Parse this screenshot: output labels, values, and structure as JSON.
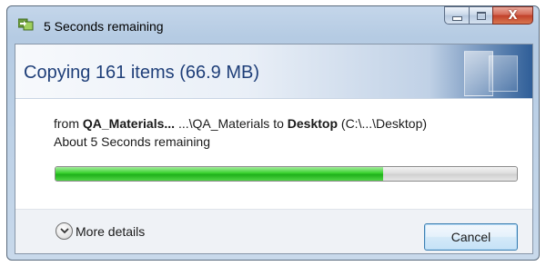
{
  "window": {
    "title": "5 Seconds remaining",
    "title_icon": "copy-progress-icon"
  },
  "caption_buttons": {
    "minimize_icon": "minimize-icon",
    "maximize_icon": "maximize-icon",
    "close_glyph": "X"
  },
  "header": {
    "title": "Copying 161 items (66.9 MB)"
  },
  "transfer": {
    "from_word": "from",
    "source_name": "QA_Materials...",
    "source_path": "...\\QA_Materials",
    "to_word": "to",
    "destination_name": "Desktop",
    "destination_path": "(C:\\...\\Desktop)",
    "remaining_text": "About 5 Seconds remaining"
  },
  "progress": {
    "fraction": 0.71,
    "color": "#22b61d"
  },
  "footer": {
    "more_details_label": "More details",
    "more_details_icon": "chevron-down-icon",
    "cancel_label": "Cancel"
  },
  "colors": {
    "header_title": "#1f3f79",
    "close_button": "#c2402a",
    "button_border": "#3c7fb1"
  }
}
